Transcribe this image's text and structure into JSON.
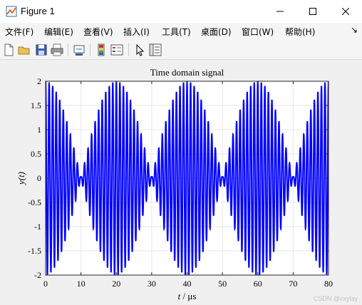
{
  "window": {
    "title": "Figure 1",
    "icon": "matlab-figure-icon",
    "controls": [
      "minimize",
      "maximize",
      "close"
    ]
  },
  "menu": {
    "items": [
      "文件(F)",
      "编辑(E)",
      "查看(V)",
      "插入(I)",
      "工具(T)",
      "桌面(D)",
      "窗口(W)",
      "帮助(H)"
    ],
    "more": "↘"
  },
  "toolbar": {
    "buttons": [
      "new-figure-icon",
      "open-file-icon",
      "save-icon",
      "print-icon",
      "link-plot-icon",
      "insert-colorbar-icon",
      "insert-legend-icon",
      "edit-plot-icon",
      "property-inspector-icon"
    ]
  },
  "colors": {
    "series": "#0000ff",
    "axes_bg": "#ffffff",
    "grid": "#e6e6e6"
  },
  "watermark": "CSDN @cxylay",
  "chart_data": {
    "type": "line",
    "title": "Time domain signal",
    "xlabel_var": "t",
    "xlabel_unit": " / μs",
    "ylabel_var": "y(t)",
    "xlim": [
      0,
      80
    ],
    "ylim": [
      -2,
      2
    ],
    "xticks": [
      0,
      10,
      20,
      30,
      40,
      50,
      60,
      70,
      80
    ],
    "yticks": [
      2,
      1.5,
      1,
      0.5,
      0,
      -0.5,
      -1,
      -1.5,
      -2
    ],
    "grid": true,
    "series": [
      {
        "color": "#0000ff",
        "carrier_cycles_per_unit": 1,
        "envelope_period": 20,
        "amplitude": 2
      }
    ]
  }
}
